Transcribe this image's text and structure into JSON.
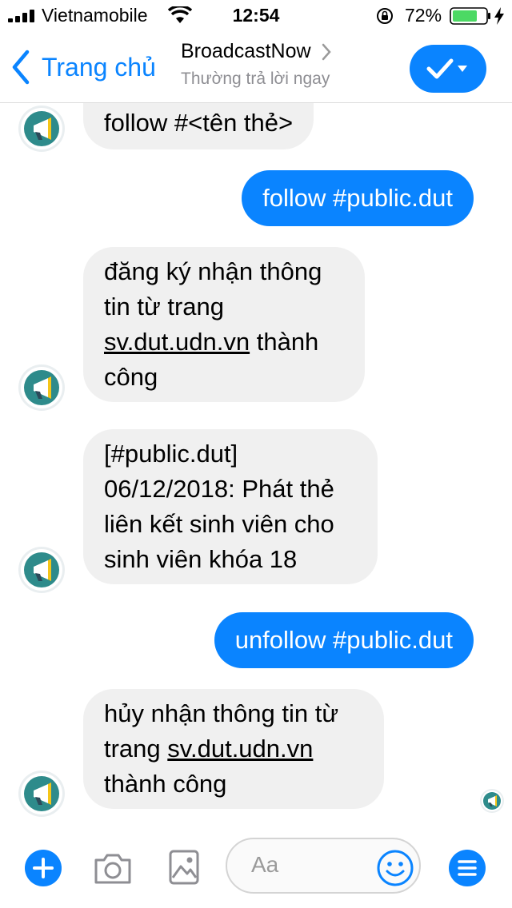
{
  "status_bar": {
    "carrier": "Vietnamobile",
    "time": "12:54",
    "battery_percent": "72%",
    "icons": [
      "signal-icon",
      "wifi-icon",
      "rotation-lock-icon",
      "battery-icon",
      "charging-icon"
    ]
  },
  "nav": {
    "back_label": "Trang chủ",
    "title": "BroadcastNow",
    "subtitle": "Thường trả lời ngay",
    "action_icons": [
      "check-icon",
      "caret-down-icon"
    ]
  },
  "messages": [
    {
      "direction": "incoming",
      "lines": [
        "follow #<tên thẻ>"
      ]
    },
    {
      "direction": "outgoing",
      "lines": [
        "follow #public.dut"
      ]
    },
    {
      "direction": "incoming",
      "lines": [
        "đăng ký nhận thông",
        "tin từ trang"
      ],
      "link": "sv.dut.udn.vn",
      "after_link": " thành",
      "tail": "công"
    },
    {
      "direction": "incoming",
      "lines": [
        "[#public.dut]",
        "06/12/2018: Phát thẻ",
        "liên kết sinh viên cho",
        "sinh viên khóa 18"
      ]
    },
    {
      "direction": "outgoing",
      "lines": [
        "unfollow #public.dut"
      ]
    },
    {
      "direction": "incoming",
      "lines": [
        "hủy nhận thông tin từ"
      ],
      "prefix": "trang ",
      "link": "sv.dut.udn.vn",
      "tail": "thành công"
    }
  ],
  "composer": {
    "placeholder": "Aa",
    "icons": [
      "plus-icon",
      "camera-icon",
      "image-icon",
      "emoji-icon",
      "menu-icon"
    ]
  },
  "colors": {
    "accent": "#0a84ff",
    "incoming_bubble": "#f0f0f0",
    "avatar_teal": "#2e8b8b"
  }
}
